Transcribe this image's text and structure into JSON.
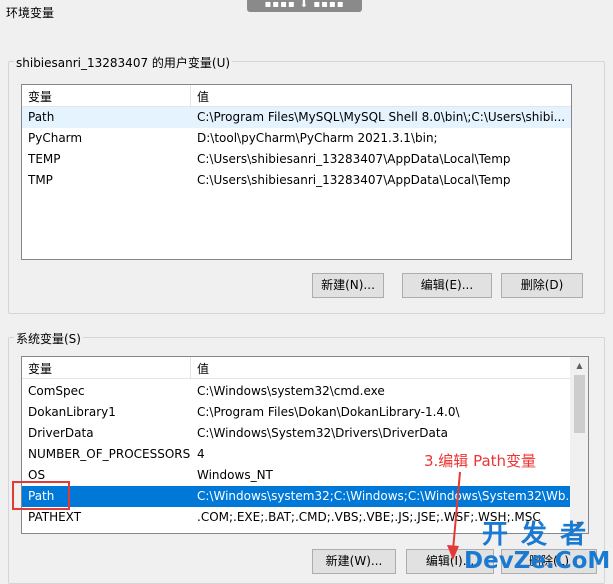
{
  "window": {
    "title": "环境变量",
    "topbar_glyph": "▪▪▪▪ ⬇ ▪▪▪▪"
  },
  "user_vars": {
    "legend": "shibiesanri_13283407 的用户变量(U)",
    "col_var": "变量",
    "col_val": "值",
    "rows": [
      {
        "name": "Path",
        "value": "C:\\Program Files\\MySQL\\MySQL Shell 8.0\\bin\\;C:\\Users\\shibi..."
      },
      {
        "name": "PyCharm",
        "value": "D:\\tool\\pyCharm\\PyCharm 2021.3.1\\bin;"
      },
      {
        "name": "TEMP",
        "value": "C:\\Users\\shibiesanri_13283407\\AppData\\Local\\Temp"
      },
      {
        "name": "TMP",
        "value": "C:\\Users\\shibiesanri_13283407\\AppData\\Local\\Temp"
      }
    ],
    "buttons": {
      "new": "新建(N)...",
      "edit": "编辑(E)...",
      "delete": "删除(D)"
    }
  },
  "sys_vars": {
    "legend": "系统变量(S)",
    "col_var": "变量",
    "col_val": "值",
    "rows": [
      {
        "name": "ComSpec",
        "value": "C:\\Windows\\system32\\cmd.exe"
      },
      {
        "name": "DokanLibrary1",
        "value": "C:\\Program Files\\Dokan\\DokanLibrary-1.4.0\\"
      },
      {
        "name": "DriverData",
        "value": "C:\\Windows\\System32\\Drivers\\DriverData"
      },
      {
        "name": "NUMBER_OF_PROCESSORS",
        "value": "4"
      },
      {
        "name": "OS",
        "value": "Windows_NT"
      },
      {
        "name": "Path",
        "value": "C:\\Windows\\system32;C:\\Windows;C:\\Windows\\System32\\Wb..."
      },
      {
        "name": "PATHEXT",
        "value": ".COM;.EXE;.BAT;.CMD;.VBS;.VBE;.JS;.JSE;.WSF;.WSH;.MSC"
      }
    ],
    "buttons": {
      "new": "新建(W)...",
      "edit": "编辑(I)...",
      "delete": "删除(L)"
    }
  },
  "annotation": {
    "text": "3.编辑 Path变量",
    "color": "#ee3333"
  },
  "watermark": {
    "line1": "开 发 者",
    "line2": "DevZe.CoM"
  }
}
